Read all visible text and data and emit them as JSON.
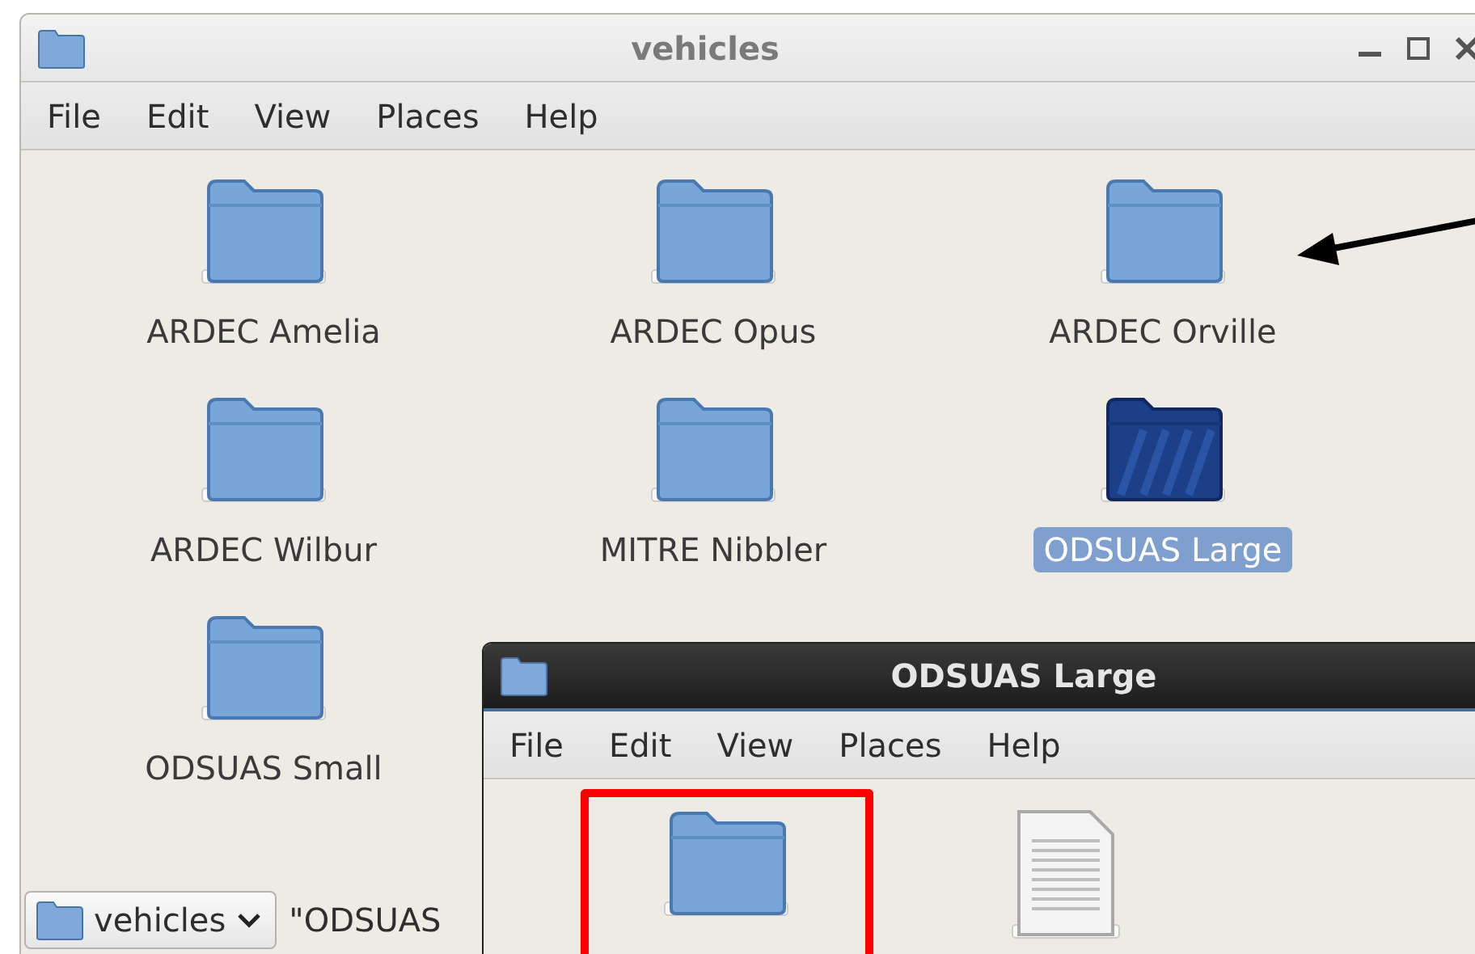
{
  "main_window": {
    "title": "vehicles",
    "active": false,
    "menu": [
      "File",
      "Edit",
      "View",
      "Places",
      "Help"
    ],
    "items": [
      {
        "label": "ARDEC Amelia",
        "kind": "folder",
        "selected": false
      },
      {
        "label": "ARDEC Opus",
        "kind": "folder",
        "selected": false
      },
      {
        "label": "ARDEC Orville",
        "kind": "folder",
        "selected": false
      },
      {
        "label": "ARDEC Wilbur",
        "kind": "folder",
        "selected": false
      },
      {
        "label": "MITRE Nibbler",
        "kind": "folder",
        "selected": false
      },
      {
        "label": "ODSUAS Large",
        "kind": "folder",
        "selected": true
      },
      {
        "label": "ODSUAS Small",
        "kind": "folder",
        "selected": false
      }
    ],
    "location": "vehicles",
    "status": "\"ODSUAS"
  },
  "second_window": {
    "title": "ODSUAS Large",
    "active": true,
    "menu": [
      "File",
      "Edit",
      "View",
      "Places",
      "Help"
    ],
    "items": [
      {
        "kind": "folder",
        "selected": false,
        "highlighted": true
      },
      {
        "kind": "document",
        "selected": false,
        "highlighted": false
      }
    ]
  },
  "annotations": [
    {
      "kind": "arrow"
    }
  ]
}
